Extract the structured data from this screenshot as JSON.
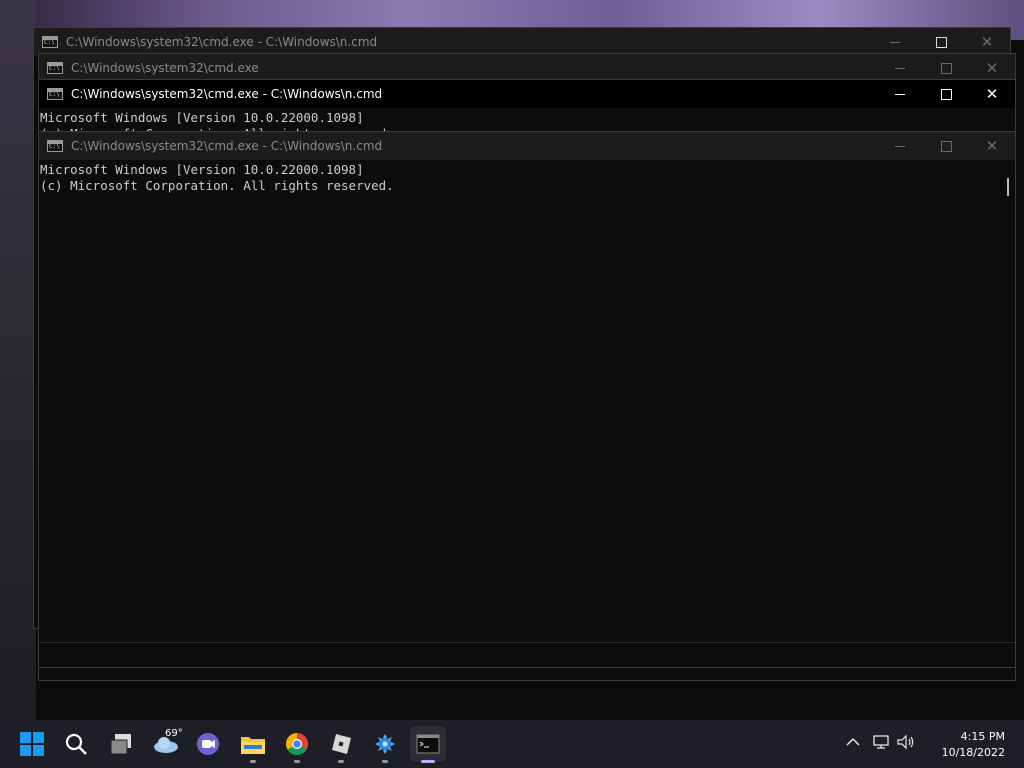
{
  "windows": [
    {
      "title": "C:\\Windows\\system32\\cmd.exe - C:\\Windows\\n.cmd",
      "state": "inactive",
      "lines": []
    },
    {
      "title": "C:\\Windows\\system32\\cmd.exe",
      "state": "inactive",
      "lines": []
    },
    {
      "title": "C:\\Windows\\system32\\cmd.exe - C:\\Windows\\n.cmd",
      "state": "active",
      "lines": [
        "Microsoft Windows [Version 10.0.22000.1098]",
        "(c) Microsoft Corporation. All rights reserved."
      ]
    },
    {
      "title": "C:\\Windows\\system32\\cmd.exe - C:\\Windows\\n.cmd",
      "state": "inactive",
      "lines": [
        "Microsoft Windows [Version 10.0.22000.1098]",
        "(c) Microsoft Corporation. All rights reserved."
      ]
    }
  ],
  "window_controls": {
    "minimize": "—",
    "maximize": "□",
    "close": "✕"
  },
  "taskbar": {
    "weather_temp": "69°",
    "icons": [
      "start-icon",
      "search-icon",
      "task-view-icon",
      "weather-icon",
      "teams-chat-icon",
      "file-explorer-icon",
      "chrome-icon",
      "roblox-icon",
      "app-icon",
      "terminal-icon"
    ],
    "tray": {
      "chevron": "^",
      "time": "4:15 PM",
      "date": "10/18/2022"
    }
  },
  "colors": {
    "console_bg": "#0c0c0c",
    "console_text": "#cccccc",
    "taskbar_bg": "#1e1f26",
    "start_blue": "#1a9bf0"
  }
}
